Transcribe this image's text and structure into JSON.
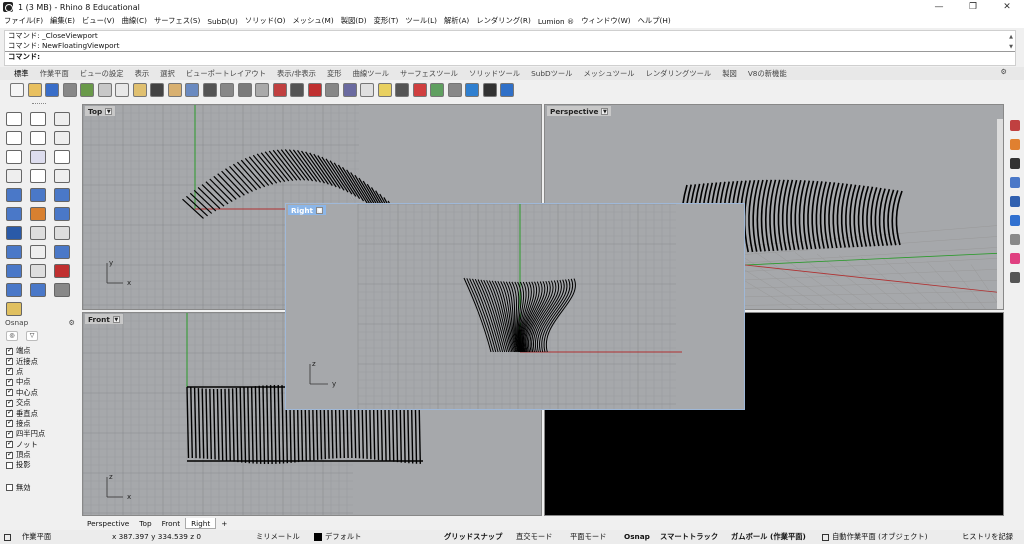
{
  "window": {
    "title": "1 (3 MB) - Rhino 8 Educational",
    "minimize_glyph": "—",
    "restore_glyph": "❐",
    "close_glyph": "✕"
  },
  "menu": [
    "ファイル(F)",
    "編集(E)",
    "ビュー(V)",
    "曲線(C)",
    "サーフェス(S)",
    "SubD(U)",
    "ソリッド(O)",
    "メッシュ(M)",
    "製図(D)",
    "変形(T)",
    "ツール(L)",
    "解析(A)",
    "レンダリング(R)",
    "Lumion ®",
    "ウィンドウ(W)",
    "ヘルプ(H)"
  ],
  "command": {
    "history": [
      "コマンド: _CloseViewport",
      "コマンド: NewFloatingViewport"
    ],
    "prompt": "コマンド:"
  },
  "tabs": [
    "標準",
    "作業平面",
    "ビューの設定",
    "表示",
    "選択",
    "ビューポートレイアウト",
    "表示/非表示",
    "変形",
    "曲線ツール",
    "サーフェスツール",
    "ソリッドツール",
    "SubDツール",
    "メッシュツール",
    "レンダリングツール",
    "製図",
    "V8の新機能"
  ],
  "toolbar_icons": [
    "new-file-icon",
    "open-file-icon",
    "save-icon",
    "print-icon",
    "import-icon",
    "cut-icon",
    "copy-icon",
    "paste-icon",
    "undo-icon",
    "pan-icon",
    "rotate-view-icon",
    "zoom-icon",
    "zoom-window-icon",
    "zoom-extents-icon",
    "zoom-selected-icon",
    "rotate-icon",
    "four-view-icon",
    "car-icon",
    "camera-icon",
    "wire-icon",
    "box-select-icon",
    "light-icon",
    "lock-icon",
    "paint-icon",
    "material-icon",
    "sphere-render-icon",
    "globe-icon",
    "options-icon",
    "help-icon"
  ],
  "palette_icons": [
    "select-icon",
    "point-icon",
    "polyline-icon",
    "curve-icon",
    "circle-icon",
    "arc-icon",
    "ellipse-icon",
    "rectangle-icon",
    "polygon-icon",
    "fillet-curve-icon",
    "extend-icon",
    "offset-icon",
    "surface-icon",
    "extrude-surface-icon",
    "loft-icon",
    "box-icon",
    "cylinder-icon",
    "sphere-icon",
    "boolean-icon",
    "trim-icon",
    "split-icon",
    "text-icon",
    "dimension-icon",
    "array-icon",
    "block-icon",
    "group-icon",
    "layer-icon",
    "mesh-icon",
    "transform-icon",
    "analyze-icon",
    "render-icon"
  ],
  "osnap": {
    "title": "Osnap",
    "items": [
      {
        "label": "端点",
        "checked": true
      },
      {
        "label": "近接点",
        "checked": true
      },
      {
        "label": "点",
        "checked": true
      },
      {
        "label": "中点",
        "checked": true
      },
      {
        "label": "中心点",
        "checked": true
      },
      {
        "label": "交点",
        "checked": true
      },
      {
        "label": "垂直点",
        "checked": true
      },
      {
        "label": "接点",
        "checked": true
      },
      {
        "label": "四半円点",
        "checked": true
      },
      {
        "label": "ノット",
        "checked": true
      },
      {
        "label": "頂点",
        "checked": true
      },
      {
        "label": "投影",
        "checked": false
      }
    ],
    "disable_label": "無効"
  },
  "viewports": {
    "top": "Top",
    "perspective": "Perspective",
    "front": "Front",
    "right": "Right"
  },
  "axes": {
    "x": "x",
    "y": "y",
    "z": "z"
  },
  "viewport_tabs": [
    "Perspective",
    "Top",
    "Front",
    "Right"
  ],
  "add_tab": "+",
  "status": {
    "cplane": "作業平面",
    "coords": "x 387.397   y 334.539   z 0",
    "units": "ミリメートル",
    "layer": "デフォルト",
    "grid_snap": "グリッドスナップ",
    "ortho": "直交モード",
    "planar": "平面モード",
    "osnap": "Osnap",
    "smarttrack": "スマートトラック",
    "gumball": "ガムボール (作業平面)",
    "auto_cplane": "自動作業平面 (オブジェクト)",
    "history": "ヒストリを記録"
  },
  "colors": {
    "viewport_bg": "#a6a8ab",
    "grid_line": "#9a9c9f",
    "grid_major": "#8a8c8f",
    "active_label": "#8cb6e8",
    "x_axis": "#b03030",
    "y_axis": "#2a9a2a"
  }
}
